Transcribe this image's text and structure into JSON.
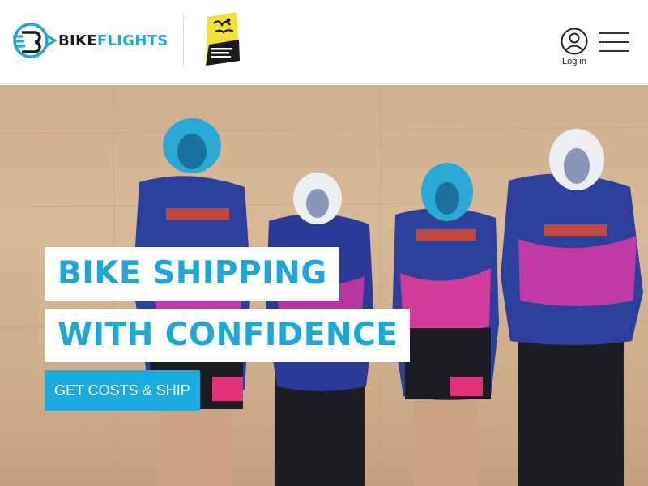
{
  "header": {
    "brand": {
      "name_part1": "BIKE",
      "name_part2": "FLIGHTS",
      "icon": "bikeflights-logo-icon"
    },
    "partner_logo": {
      "icon": "tour-de-france-official-service-logo",
      "text": "Tour de France OFFICIAL SERVICE"
    },
    "login_label": "Log in",
    "login_icon": "user-circle-icon",
    "menu_icon": "hamburger-menu-icon"
  },
  "hero": {
    "headline_line1": "BIKE SHIPPING",
    "headline_line2": "WITH CONFIDENCE",
    "cta_label": "GET COSTS & SHIP",
    "image": "four cyclists in team kit and helmets standing against a travertine wall"
  },
  "colors": {
    "brand_blue": "#19a8d9",
    "cta_blue": "#1aace0",
    "partner_yellow": "#f4e232",
    "text_dark": "#1a1a1a"
  }
}
